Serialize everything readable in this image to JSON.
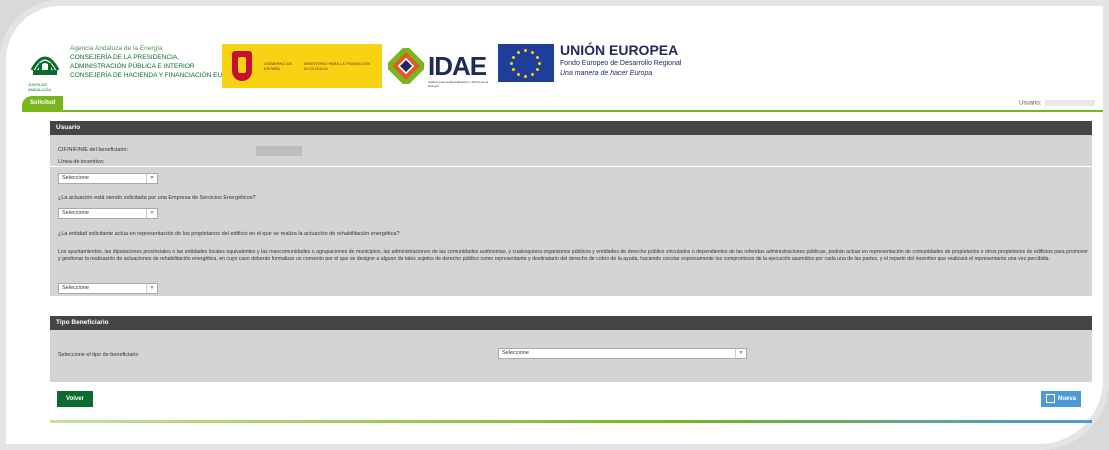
{
  "header": {
    "junta_lines": [
      "Agencia Andaluza de la Energía",
      "CONSEJERÍA DE LA PRESIDENCIA,",
      "ADMINISTRACIÓN PÚBLICA E INTERIOR",
      "CONSEJERÍA DE HACIENDA Y FINANCIACIÓN EUROPEA"
    ],
    "junta_sub": "JUNTA DE ANDALUCÍA",
    "gobierno": "GOBIERNO DE ESPAÑA",
    "ministerio": "MINISTERIO PARA LA TRANSICIÓN ECOLÓGICA",
    "idae": "IDAE",
    "idae_sub": "Instituto para la Diversificación y Ahorro de la Energía",
    "eu_title": "UNIÓN EUROPEA",
    "eu_fondo": "Fondo Europeo de Desarrollo Regional",
    "eu_lema": "Una manera de hacer Europa"
  },
  "tabbar": {
    "tab_label": "Solicitud",
    "usuario_label": "Usuario:"
  },
  "usuario_panel": {
    "title": "Usuario",
    "cif_label": "CIF/NIF/NIE del beneficiario:",
    "linea_label": "Línea de incentivo:",
    "linea_select": "Seleccione",
    "ese_label": "¿La actuación está siendo solicitada por una Empresa de Servicios Energéticos?",
    "ese_select": "Seleccione",
    "representacion_label": "¿La entidad solicitante actúa en representación de los propietarios del edificio en el que se realiza la actuación de rehabilitación energética?",
    "paragraph": "Los ayuntamientos, las diputaciones provinciales o las entidades locales equivalentes y las mancomunidades o agrupaciones de municipios, las administraciones de las comunidades autónomas, y cualesquiera organismos públicos y entidades de derecho público vinculados o dependientes de las referidas administraciones públicas, podrán actuar en representación de comunidades de propietarios o otros propietarios de edificios para promover y gestionar la realización de actuaciones de rehabilitación energética, en cuyo caso deberán formalizar un convenio por el que se designe a alguno de tales sujetos de derecho público como representante y destinatario del derecho de cobro de la ayuda, haciendo constar expresamente los compromisos de la ejecución asumidos por cada una de las partes, y el reparto del incentivo que realizará el representante una vez percibida.",
    "representacion_select": "Seleccione"
  },
  "tipo_panel": {
    "title": "Tipo Beneficiario",
    "tipo_label": "Seleccione el tipo de beneficiario",
    "tipo_select": "Seleccione"
  },
  "buttons": {
    "volver": "Volver",
    "nueva": "Nueva"
  },
  "colors": {
    "green_dark": "#0a6b2e",
    "green_light": "#7ab51d",
    "panel_header": "#454545",
    "blue_button": "#4d9ad6"
  }
}
